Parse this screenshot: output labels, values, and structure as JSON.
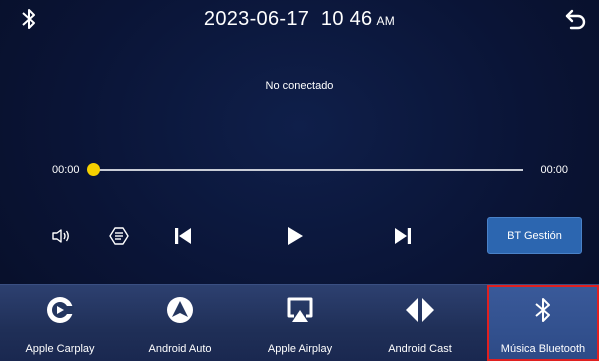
{
  "status": {
    "bluetooth_icon": "bluetooth-icon",
    "date": "2023-06-17",
    "time": "10 46",
    "ampm": "AM",
    "back_icon": "back-arrow-icon"
  },
  "player": {
    "connection_status": "No conectado",
    "current_time": "00:00",
    "total_time": "00:00",
    "progress": 0,
    "accent_color": "#f5d000",
    "controls": {
      "volume_icon": "speaker-icon",
      "playlist_icon": "list-icon",
      "prev_icon": "skip-previous-icon",
      "play_icon": "play-icon",
      "next_icon": "skip-next-icon"
    },
    "bt_manage_label": "BT Gestión"
  },
  "apps": [
    {
      "label": "Apple Carplay",
      "icon": "carplay-icon",
      "active": false
    },
    {
      "label": "Android Auto",
      "icon": "android-auto-icon",
      "active": false
    },
    {
      "label": "Apple Airplay",
      "icon": "airplay-icon",
      "active": false
    },
    {
      "label": "Android Cast",
      "icon": "cast-icon",
      "active": false
    },
    {
      "label": "Música Bluetooth",
      "icon": "bluetooth-music-icon",
      "active": true
    }
  ]
}
